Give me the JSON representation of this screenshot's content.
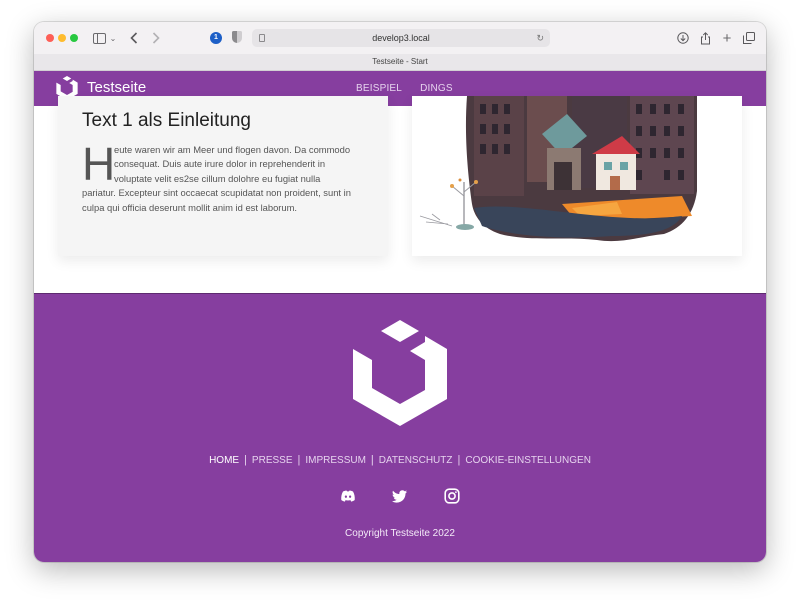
{
  "browser": {
    "url": "develop3.local",
    "tab_title": "Testseite - Start"
  },
  "site": {
    "brand": "Testseite",
    "nav": [
      "BEISPIEL",
      "DINGS"
    ]
  },
  "intro": {
    "title": "Text 1 als Einleitung",
    "drop_cap": "H",
    "lines": [
      "eute waren wir am Meer und flogen davon. Da commodo",
      "consequat. Duis aute irure dolor in reprehenderit in",
      "voluptate velit es2se cillum dolohre eu fugiat nulla",
      "pariatur. Excepteur sint occaecat scupidatat non proident, sunt in",
      "culpa qui officia deserunt mollit anim id est laborum."
    ]
  },
  "footer": {
    "links": [
      "HOME",
      "PRESSE",
      "IMPRESSUM",
      "DATENSCHUTZ",
      "COOKIE-EINSTELLUNGEN"
    ],
    "active_link": "HOME",
    "socials": [
      "discord-icon",
      "twitter-icon",
      "instagram-icon"
    ],
    "copyright": "Copyright Testseite 2022"
  },
  "colors": {
    "brand_purple": "#863e9f",
    "nav_text": "#e6d3ee"
  }
}
